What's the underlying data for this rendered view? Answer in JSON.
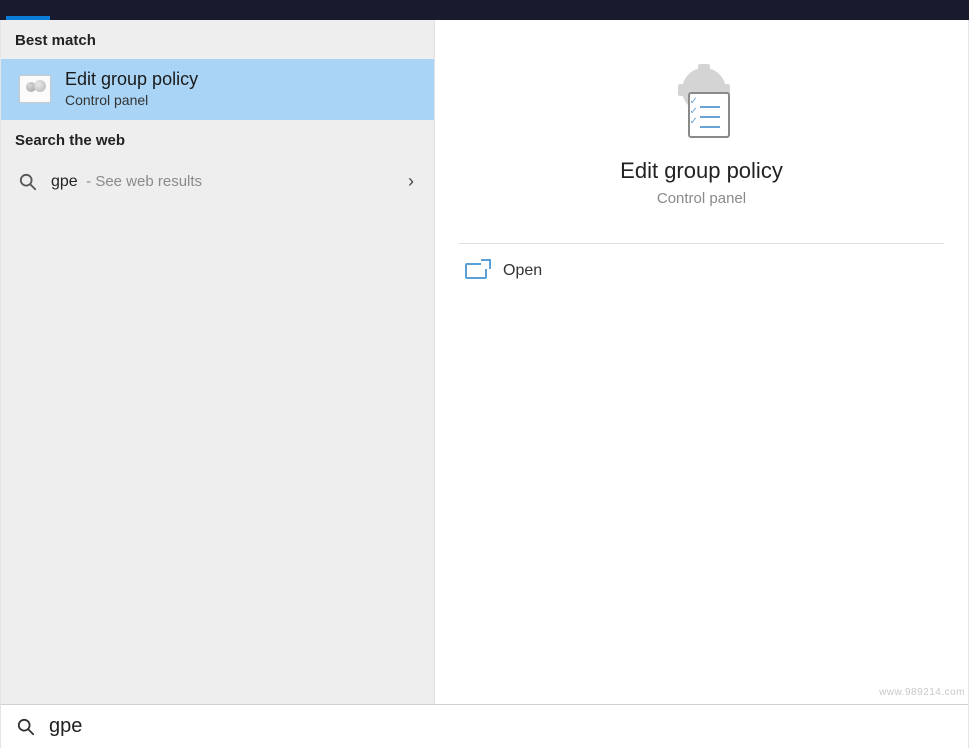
{
  "sections": {
    "best_match_header": "Best match",
    "search_web_header": "Search the web"
  },
  "best_match": {
    "title": "Edit group policy",
    "subtitle": "Control panel"
  },
  "web_result": {
    "query": "gpe",
    "hint": "- See web results"
  },
  "detail": {
    "title": "Edit group policy",
    "subtitle": "Control panel"
  },
  "actions": {
    "open": "Open"
  },
  "search_input": {
    "value": "gpe"
  },
  "watermark": "www.989214.com"
}
